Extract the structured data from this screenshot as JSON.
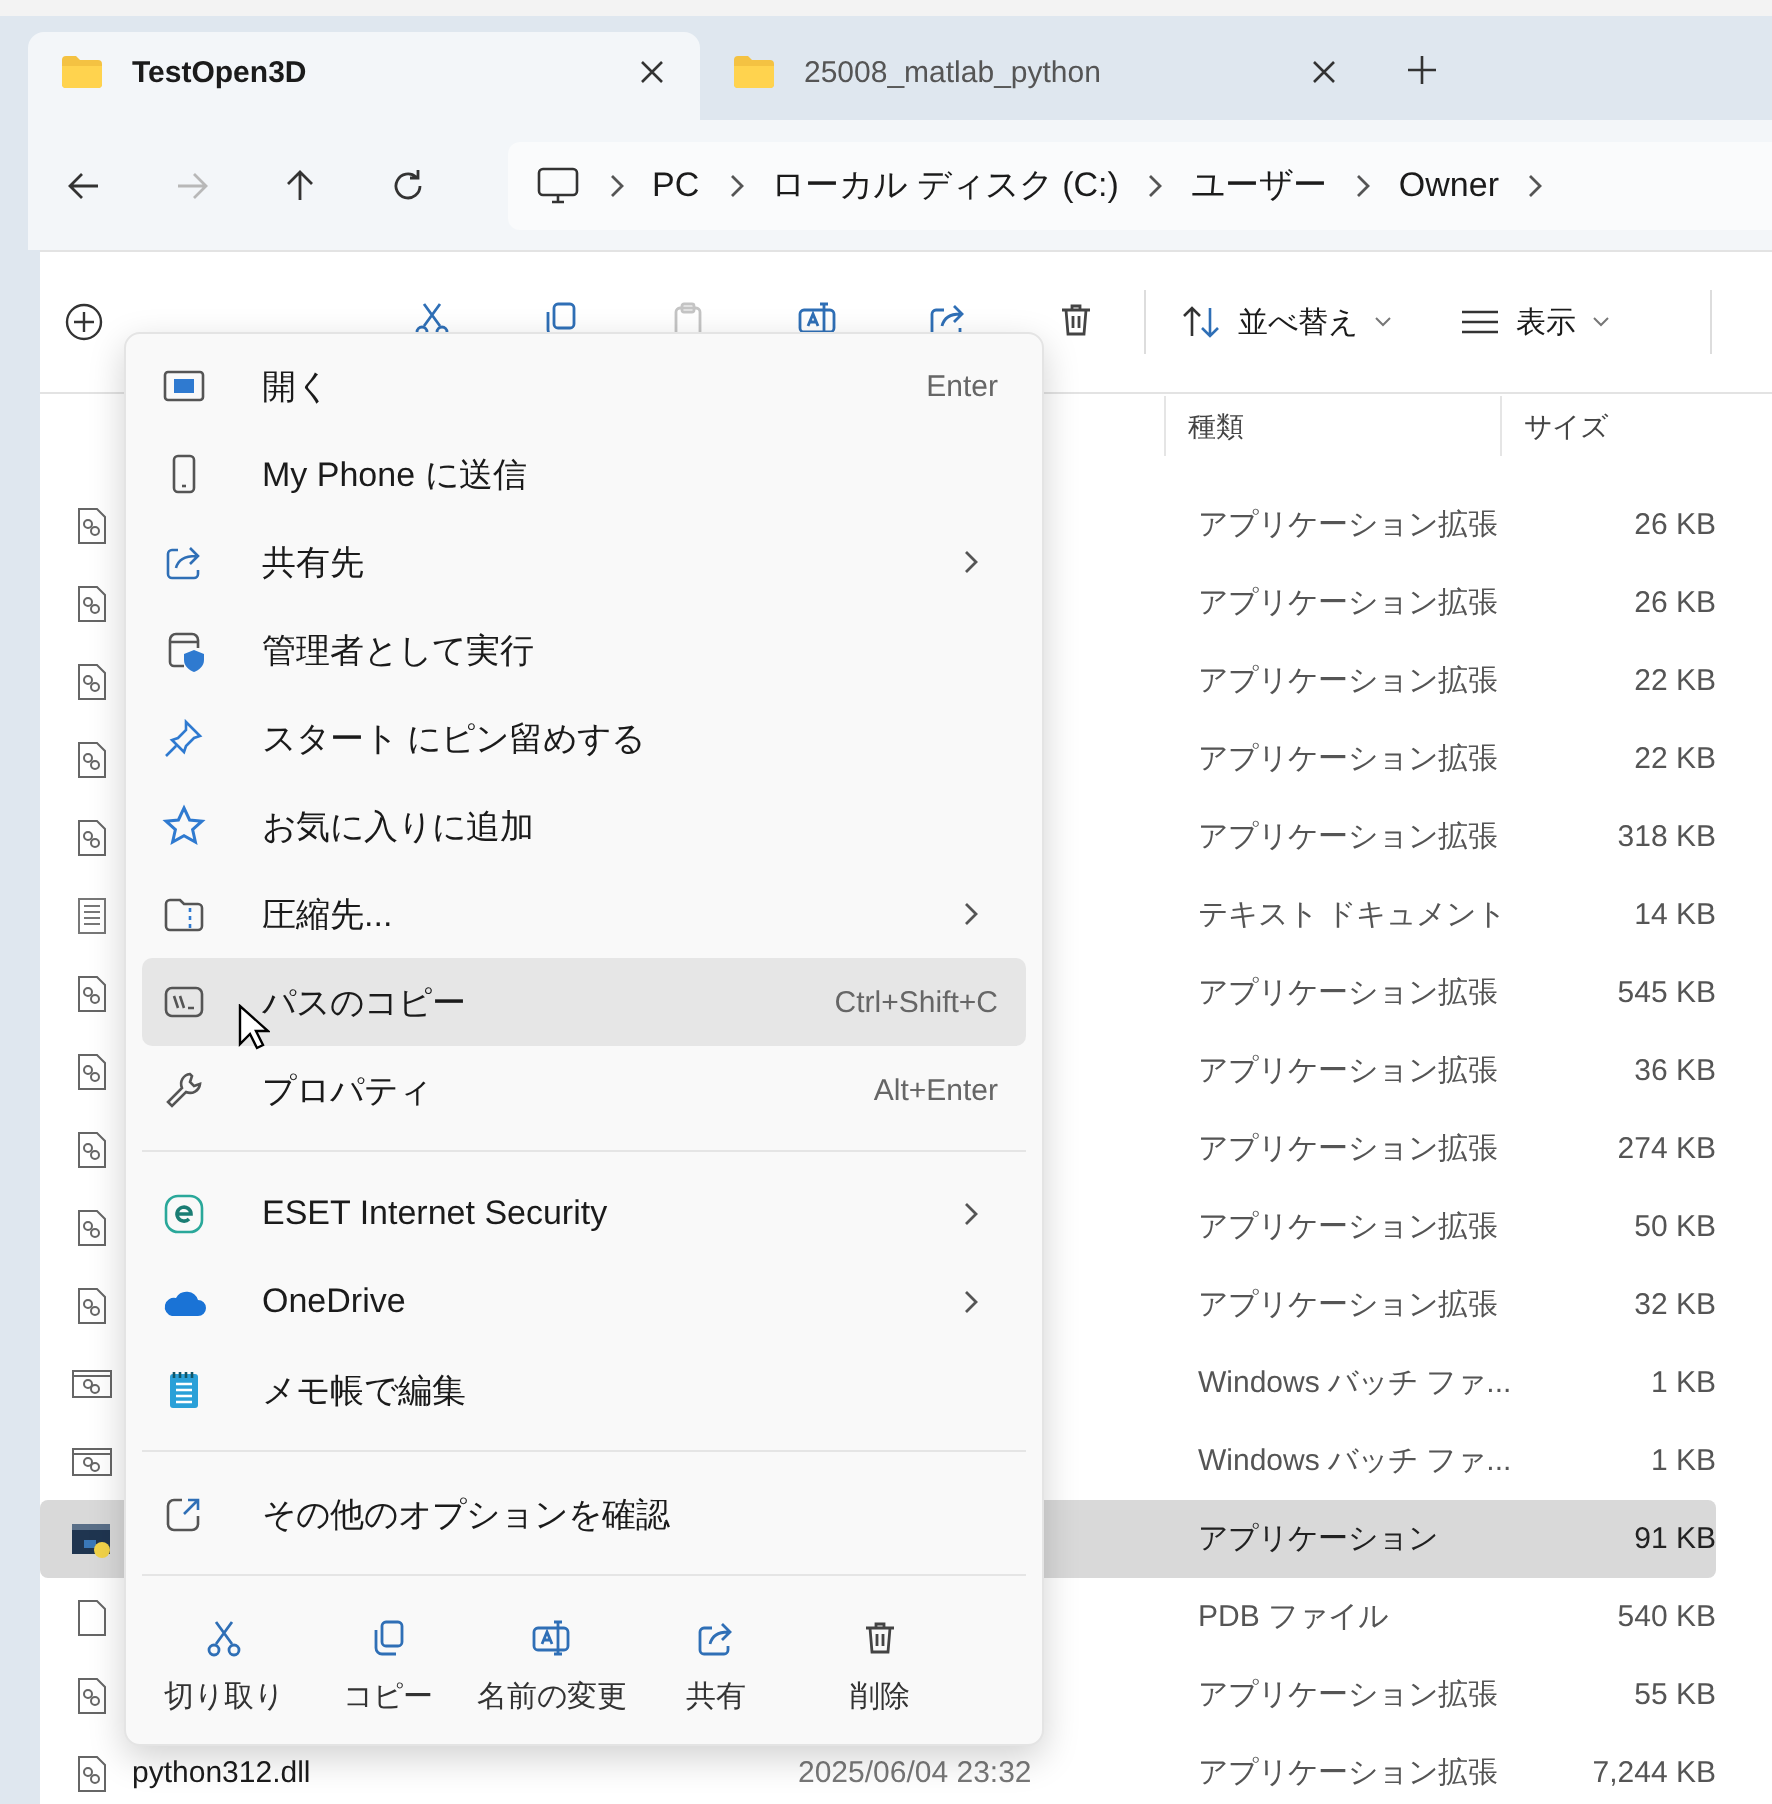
{
  "tabs": [
    {
      "label": "TestOpen3D",
      "selected": true
    },
    {
      "label": "25008_matlab_python",
      "selected": false
    }
  ],
  "nav_buttons": [
    {
      "kind": "back",
      "disabled": false
    },
    {
      "kind": "forward",
      "disabled": true
    },
    {
      "kind": "up",
      "disabled": false
    },
    {
      "kind": "refresh",
      "disabled": false
    }
  ],
  "breadcrumb": [
    "PC",
    "ローカル ディスク (C:)",
    "ユーザー",
    "Owner"
  ],
  "toolbar": {
    "actions": [
      {
        "kind": "cut",
        "disabled": false
      },
      {
        "kind": "copy",
        "disabled": false
      },
      {
        "kind": "paste",
        "disabled": true
      },
      {
        "kind": "rename",
        "disabled": false
      },
      {
        "kind": "share",
        "disabled": false
      },
      {
        "kind": "delete",
        "disabled": false
      }
    ],
    "sort": "並べ替え",
    "view": "表示"
  },
  "columns": [
    "種類",
    "サイズ"
  ],
  "rows": [
    {
      "kind": "dll",
      "type": "アプリケーション拡張",
      "size": "26 KB",
      "selected": false
    },
    {
      "kind": "dll",
      "type": "アプリケーション拡張",
      "size": "26 KB",
      "selected": false
    },
    {
      "kind": "dll",
      "type": "アプリケーション拡張",
      "size": "22 KB",
      "selected": false
    },
    {
      "kind": "dll",
      "type": "アプリケーション拡張",
      "size": "22 KB",
      "selected": false
    },
    {
      "kind": "dll",
      "type": "アプリケーション拡張",
      "size": "318 KB",
      "selected": false
    },
    {
      "kind": "text",
      "type": "テキスト ドキュメント",
      "size": "14 KB",
      "selected": false
    },
    {
      "kind": "dll",
      "type": "アプリケーション拡張",
      "size": "545 KB",
      "selected": false
    },
    {
      "kind": "dll",
      "type": "アプリケーション拡張",
      "size": "36 KB",
      "selected": false
    },
    {
      "kind": "dll",
      "type": "アプリケーション拡張",
      "size": "274 KB",
      "selected": false
    },
    {
      "kind": "dll",
      "type": "アプリケーション拡張",
      "size": "50 KB",
      "selected": false
    },
    {
      "kind": "dll",
      "type": "アプリケーション拡張",
      "size": "32 KB",
      "selected": false
    },
    {
      "kind": "batch",
      "type": "Windows バッチ ファ...",
      "size": "1 KB",
      "selected": false
    },
    {
      "kind": "batch",
      "type": "Windows バッチ ファ...",
      "size": "1 KB",
      "selected": false
    },
    {
      "kind": "app",
      "type": "アプリケーション",
      "size": "91 KB",
      "selected": true
    },
    {
      "kind": "file",
      "type": "PDB ファイル",
      "size": "540 KB",
      "selected": false
    },
    {
      "kind": "dll",
      "type": "アプリケーション拡張",
      "size": "55 KB",
      "selected": false
    },
    {
      "kind": "dll",
      "name": "python312.dll",
      "date": "2025/06/04 23:32",
      "type": "アプリケーション拡張",
      "size": "7,244 KB",
      "selected": false
    }
  ],
  "context_menu": {
    "sections": [
      [
        {
          "label": "開く",
          "shortcut": "Enter",
          "submenu": false,
          "highlighted": false
        },
        {
          "label": "My Phone に送信",
          "submenu": false,
          "highlighted": false
        },
        {
          "label": "共有先",
          "submenu": true,
          "highlighted": false
        },
        {
          "label": "管理者として実行",
          "submenu": false,
          "highlighted": false
        },
        {
          "label": "スタート にピン留めする",
          "submenu": false,
          "highlighted": false
        },
        {
          "label": "お気に入りに追加",
          "submenu": false,
          "highlighted": false
        },
        {
          "label": "圧縮先...",
          "submenu": true,
          "highlighted": false
        },
        {
          "label": "パスのコピー",
          "shortcut": "Ctrl+Shift+C",
          "submenu": false,
          "highlighted": true
        },
        {
          "label": "プロパティ",
          "shortcut": "Alt+Enter",
          "submenu": false,
          "highlighted": false
        }
      ],
      [
        {
          "label": "ESET Internet Security",
          "submenu": true,
          "highlighted": false
        },
        {
          "label": "OneDrive",
          "submenu": true,
          "highlighted": false
        },
        {
          "label": "メモ帳で編集",
          "submenu": false,
          "highlighted": false
        }
      ],
      [
        {
          "label": "その他のオプションを確認",
          "submenu": false,
          "highlighted": false
        }
      ]
    ],
    "actions": [
      {
        "kind": "cut",
        "label": "切り取り"
      },
      {
        "kind": "copy",
        "label": "コピー"
      },
      {
        "kind": "rename",
        "label": "名前の変更"
      },
      {
        "kind": "share",
        "label": "共有"
      },
      {
        "kind": "delete",
        "label": "削除"
      }
    ]
  }
}
